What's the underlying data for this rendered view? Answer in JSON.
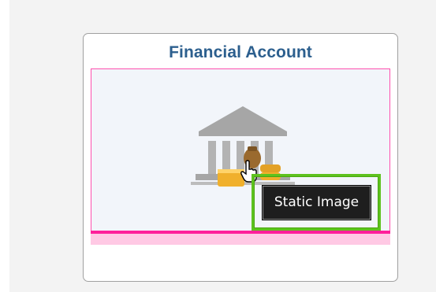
{
  "tile": {
    "title": "Financial Account",
    "image_icon": "bank-with-coins-icon"
  },
  "tooltip": {
    "text": "Static Image"
  },
  "colors": {
    "title": "#2c5f8e",
    "frame_border": "#ff4fae",
    "frame_bar": "#ff1f9a",
    "highlight": "#5ec21e",
    "tooltip_bg": "#1e1e1e"
  },
  "cursor_icon": "hand-pointer-icon"
}
